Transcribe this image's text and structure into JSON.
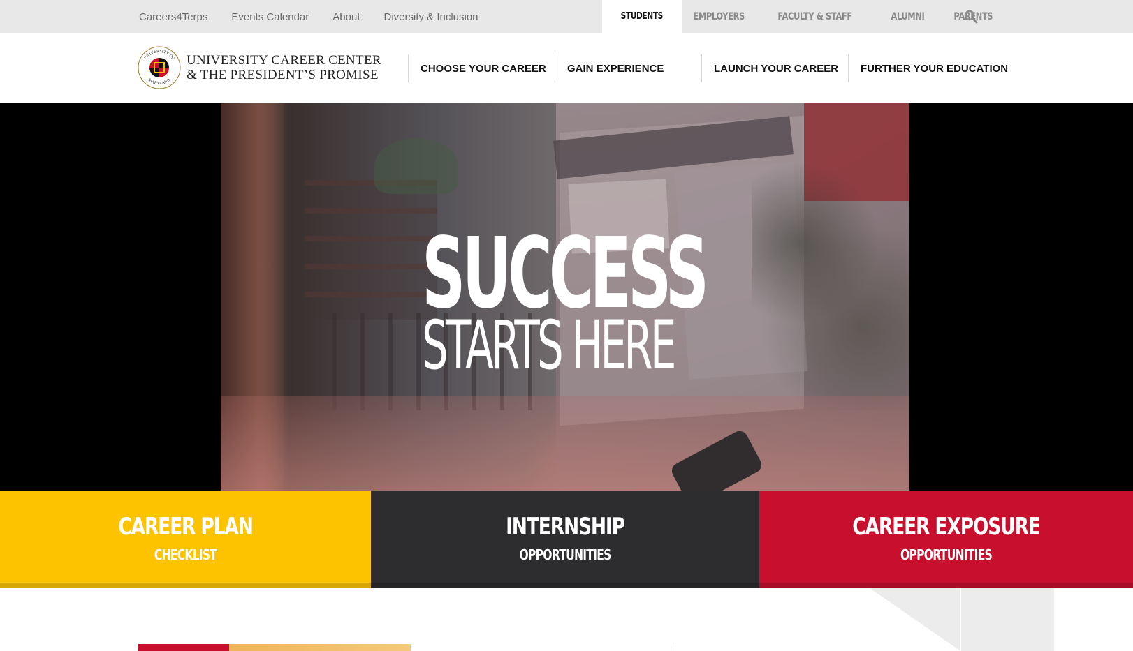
{
  "utility_nav": {
    "links": [
      "Careers4Terps",
      "Events Calendar",
      "About",
      "Diversity & Inclusion"
    ],
    "audience_tabs": [
      "STUDENTS",
      "EMPLOYERS",
      "FACULTY & STAFF",
      "ALUMNI",
      "PARENTS"
    ],
    "active_tab": "STUDENTS"
  },
  "logo": {
    "line1": "UNIVERSITY CAREER CENTER",
    "line2": "& THE PRESIDENT’S PROMISE",
    "seal_top": "UNIVERSITY OF",
    "seal_bottom": "MARYLAND"
  },
  "main_nav": [
    "CHOOSE YOUR CAREER",
    "GAIN EXPERIENCE",
    "LAUNCH YOUR CAREER",
    "FURTHER YOUR EDUCATION"
  ],
  "hero": {
    "line1": "SUCCESS",
    "line2": "STARTS HERE"
  },
  "ctas": [
    {
      "title": "CAREER PLAN",
      "subtitle": "CHECKLIST",
      "color": "#fdc300"
    },
    {
      "title": "INTERNSHIP",
      "subtitle": "OPPORTUNITIES",
      "color": "#2d2d2f"
    },
    {
      "title": "CAREER EXPOSURE",
      "subtitle": "OPPORTUNITIES",
      "color": "#c8102e"
    }
  ],
  "icons": {
    "search": "search-icon",
    "seal": "university-seal-icon"
  },
  "colors": {
    "gold": "#fdc300",
    "red": "#c8102e",
    "dark": "#2d2d2f"
  }
}
